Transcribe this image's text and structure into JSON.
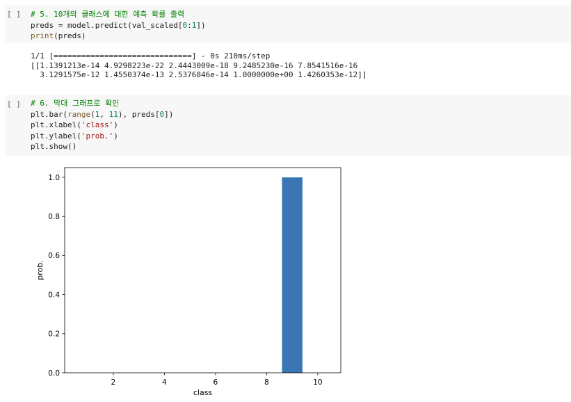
{
  "cells": [
    {
      "run_label": "[ ]",
      "lines": [
        [
          {
            "t": "# 5. 10개의 클래스에 대한 예측 확률 출력",
            "c": "comment"
          }
        ],
        [
          {
            "t": "preds = model.predict(val_scaled[",
            "c": ""
          },
          {
            "t": "0",
            "c": "num"
          },
          {
            "t": ":",
            "c": ""
          },
          {
            "t": "1",
            "c": "num"
          },
          {
            "t": "])",
            "c": ""
          }
        ],
        [
          {
            "t": "print",
            "c": "builtin"
          },
          {
            "t": "(preds)",
            "c": ""
          }
        ]
      ],
      "output": [
        "1/1 [==============================] - 0s 210ms/step",
        "[[1.1391213e-14 4.9298223e-22 2.4443009e-18 9.2485230e-16 7.8541516e-16",
        "  3.1291575e-12 1.4550374e-13 2.5376846e-14 1.0000000e+00 1.4260353e-12]]"
      ]
    },
    {
      "run_label": "[ ]",
      "lines": [
        [
          {
            "t": "# 6. 막대 그래프로 확인",
            "c": "comment"
          }
        ],
        [
          {
            "t": "plt.bar(",
            "c": ""
          },
          {
            "t": "range",
            "c": "builtin"
          },
          {
            "t": "(",
            "c": ""
          },
          {
            "t": "1",
            "c": "num"
          },
          {
            "t": ", ",
            "c": ""
          },
          {
            "t": "11",
            "c": "num"
          },
          {
            "t": "), preds[",
            "c": ""
          },
          {
            "t": "0",
            "c": "num"
          },
          {
            "t": "])",
            "c": ""
          }
        ],
        [
          {
            "t": "plt.xlabel(",
            "c": ""
          },
          {
            "t": "'class'",
            "c": "str"
          },
          {
            "t": ")",
            "c": ""
          }
        ],
        [
          {
            "t": "plt.ylabel(",
            "c": ""
          },
          {
            "t": "'prob.'",
            "c": "str"
          },
          {
            "t": ")",
            "c": ""
          }
        ],
        [
          {
            "t": "plt.show()",
            "c": ""
          }
        ]
      ]
    }
  ],
  "chart_data": {
    "type": "bar",
    "x": [
      1,
      2,
      3,
      4,
      5,
      6,
      7,
      8,
      9,
      10
    ],
    "values": [
      1.1391213e-14,
      4.9298223e-22,
      2.4443009e-18,
      9.248523e-16,
      7.8541516e-16,
      3.1291575e-12,
      1.4550374e-13,
      2.5376846e-14,
      1.0,
      1.4260353e-12
    ],
    "xlabel": "class",
    "ylabel": "prob.",
    "xlim": [
      0.1,
      10.9
    ],
    "ylim": [
      0.0,
      1.05
    ],
    "xticks": [
      2,
      4,
      6,
      8,
      10
    ],
    "yticks": [
      0.0,
      0.2,
      0.4,
      0.6,
      0.8,
      1.0
    ],
    "xtick_labels": [
      "2",
      "4",
      "6",
      "8",
      "10"
    ],
    "ytick_labels": [
      "0.0",
      "0.2",
      "0.4",
      "0.6",
      "0.8",
      "1.0"
    ],
    "bar_color": "#3a76b4",
    "grid": false
  }
}
